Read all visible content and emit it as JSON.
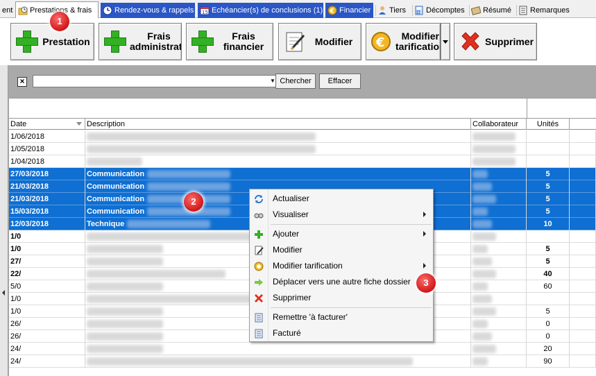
{
  "tabs": [
    {
      "label": "ents",
      "icon": "none"
    },
    {
      "label": "Prestations & frais",
      "icon": "clock-folder-icon"
    },
    {
      "label": "Rendez-vous & rappels",
      "icon": "clock-icon"
    },
    {
      "label": "Echéancier(s) de conclusions (1)",
      "icon": "calendar-icon"
    },
    {
      "label": "Financier",
      "icon": "euro-coin-icon"
    },
    {
      "label": "Tiers",
      "icon": "person-icon"
    },
    {
      "label": "Décomptes",
      "icon": "calculator-icon"
    },
    {
      "label": "Résumé",
      "icon": "notes-icon"
    },
    {
      "label": "Remarques",
      "icon": "note-icon"
    }
  ],
  "toolbar": {
    "prestation": "Prestation",
    "frais_admin": "Frais\nadministratif",
    "frais_financier": "Frais\nfinancier",
    "modifier": "Modifier",
    "modifier_tarif": "Modifier\ntarification",
    "supprimer": "Supprimer"
  },
  "filter": {
    "value": "",
    "search_button": "Chercher",
    "clear_button": "Effacer"
  },
  "grid": {
    "headers": {
      "date": "Date",
      "description": "Description",
      "collaborateur": "Collaborateur",
      "unites": "Unités"
    },
    "rows": [
      {
        "date": "1/06/2018",
        "desc": "",
        "unit": "",
        "style": "normal"
      },
      {
        "date": "1/05/2018",
        "desc": "",
        "unit": "",
        "style": "normal"
      },
      {
        "date": "1/04/2018",
        "desc": "",
        "unit": "",
        "style": "normal"
      },
      {
        "date": "27/03/2018",
        "desc": "Communication",
        "unit": "5",
        "style": "selected"
      },
      {
        "date": "21/03/2018",
        "desc": "Communication",
        "unit": "5",
        "style": "selected"
      },
      {
        "date": "21/03/2018",
        "desc": "Communication",
        "unit": "5",
        "style": "selected"
      },
      {
        "date": "15/03/2018",
        "desc": "Communication",
        "unit": "5",
        "style": "selected"
      },
      {
        "date": "12/03/2018",
        "desc": "Technique",
        "unit": "10",
        "style": "selected"
      },
      {
        "date": "1/0",
        "desc": "",
        "unit": "",
        "style": "bold"
      },
      {
        "date": "1/0",
        "desc": "",
        "unit": "5",
        "style": "bold"
      },
      {
        "date": "27/",
        "desc": "",
        "unit": "5",
        "style": "bold"
      },
      {
        "date": "22/",
        "desc": "",
        "unit": "40",
        "style": "bold"
      },
      {
        "date": "5/0",
        "desc": "",
        "unit": "60",
        "style": "normal"
      },
      {
        "date": "1/0",
        "desc": "",
        "unit": "",
        "style": "normal"
      },
      {
        "date": "1/0",
        "desc": "",
        "unit": "5",
        "style": "normal"
      },
      {
        "date": "26/",
        "desc": "",
        "unit": "0",
        "style": "normal"
      },
      {
        "date": "26/",
        "desc": "",
        "unit": "0",
        "style": "normal"
      },
      {
        "date": "24/",
        "desc": "",
        "unit": "20",
        "style": "normal"
      },
      {
        "date": "24/",
        "desc": "",
        "unit": "90",
        "style": "normal"
      }
    ]
  },
  "context_menu": {
    "items": [
      {
        "label": "Actualiser",
        "icon": "refresh-icon",
        "submenu": false
      },
      {
        "label": "Visualiser",
        "icon": "glasses-icon",
        "submenu": true
      },
      {
        "label": "Ajouter",
        "icon": "add-icon",
        "submenu": true
      },
      {
        "label": "Modifier",
        "icon": "edit-icon",
        "submenu": false
      },
      {
        "label": "Modifier tarification",
        "icon": "euro-coin-icon",
        "submenu": true
      },
      {
        "label": "Déplacer vers une autre fiche dossier",
        "icon": "move-arrow-icon",
        "submenu": false
      },
      {
        "label": "Supprimer",
        "icon": "delete-icon",
        "submenu": false
      },
      {
        "label": "Remettre 'à facturer'",
        "icon": "document-icon",
        "submenu": false
      },
      {
        "label": "Facturé",
        "icon": "document-icon",
        "submenu": false
      }
    ]
  },
  "markers": [
    "1",
    "2",
    "3"
  ],
  "colors": {
    "selection": "#0f6fd2",
    "tab_highlight": "#2a56c6",
    "marker": "#d01818",
    "add_green": "#34b025",
    "delete_red": "#e0301e"
  }
}
